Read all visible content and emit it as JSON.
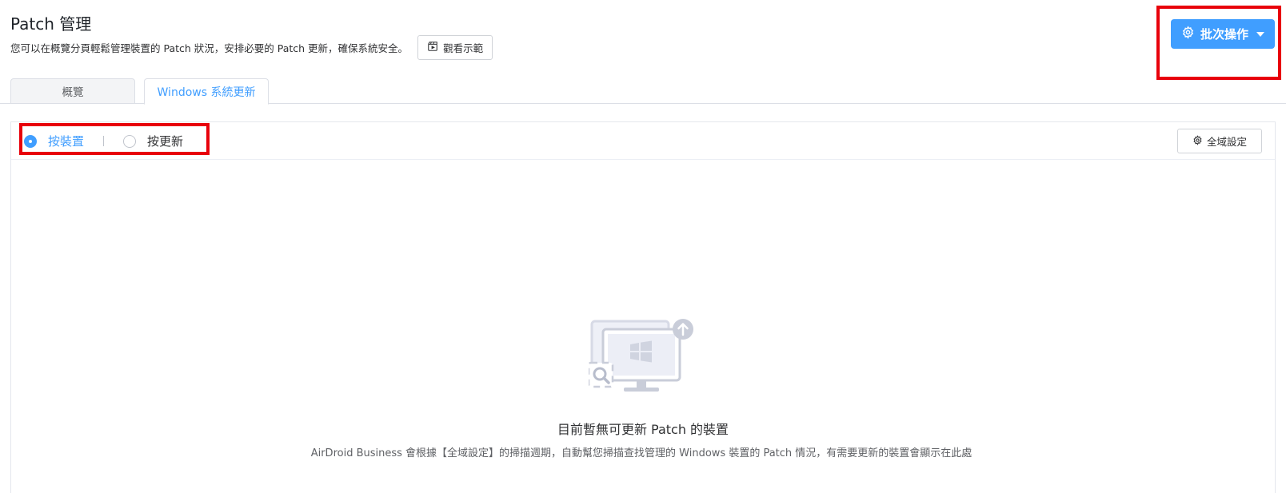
{
  "header": {
    "title": "Patch 管理",
    "description": "您可以在概覽分頁輕鬆管理裝置的 Patch 狀況，安排必要的 Patch 更新，確保系統安全。",
    "demo_button": "觀看示範",
    "batch_button": "批次操作"
  },
  "tabs": [
    {
      "label": "概覽",
      "active": false
    },
    {
      "label": "Windows 系統更新",
      "active": true
    }
  ],
  "panel": {
    "view_options": [
      {
        "label": "按裝置",
        "checked": true
      },
      {
        "label": "按更新",
        "checked": false
      }
    ],
    "global_settings_button": "全域設定"
  },
  "empty_state": {
    "title": "目前暫無可更新 Patch 的裝置",
    "description": "AirDroid Business 會根據【全域設定】的掃描週期，自動幫您掃描查找管理的 Windows 裝置的 Patch 情況，有需要更新的裝置會顯示在此處"
  },
  "colors": {
    "accent": "#409eff",
    "highlight": "#e8000b",
    "tab_inactive_bg": "#f3f4f6"
  },
  "icons": {
    "demo": "video-clapper-icon",
    "batch": "gear-icon",
    "global_settings": "gear-icon",
    "empty_state": "monitor-update-icon"
  }
}
